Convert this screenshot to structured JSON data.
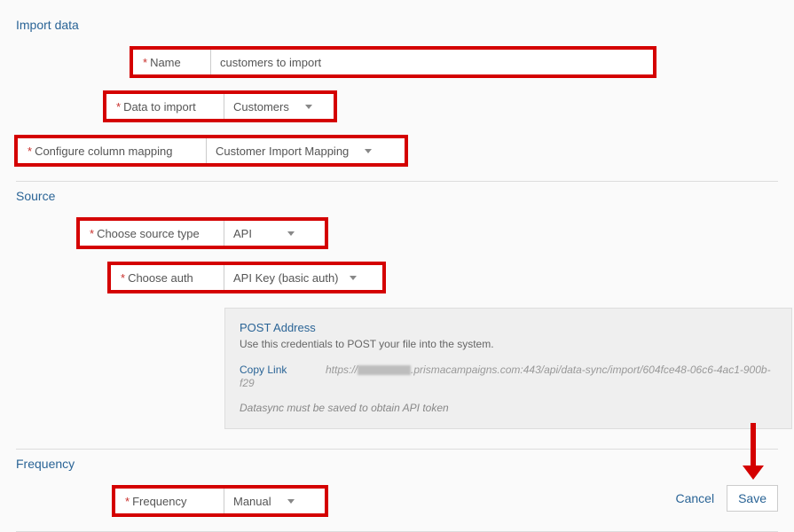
{
  "sections": {
    "import": {
      "title": "Import data"
    },
    "source": {
      "title": "Source"
    },
    "frequency": {
      "title": "Frequency"
    }
  },
  "fields": {
    "name": {
      "label": "Name",
      "value": "customers to import"
    },
    "dataToImport": {
      "label": "Data to import",
      "value": "Customers"
    },
    "columnMapping": {
      "label": "Configure column mapping",
      "value": "Customer Import Mapping"
    },
    "sourceType": {
      "label": "Choose source type",
      "value": "API"
    },
    "auth": {
      "label": "Choose auth",
      "value": "API Key (basic auth)"
    },
    "frequency": {
      "label": "Frequency",
      "value": "Manual"
    }
  },
  "infoPanel": {
    "title": "POST Address",
    "desc": "Use this credentials to POST your file into the system.",
    "copyLink": "Copy Link",
    "url_prefix": "https://",
    "url_suffix": ".prismacampaigns.com:443/api/data-sync/import/604fce48-06c6-4ac1-900b-f29",
    "note": "Datasync must be saved to obtain API token"
  },
  "actions": {
    "cancel": "Cancel",
    "save": "Save"
  }
}
